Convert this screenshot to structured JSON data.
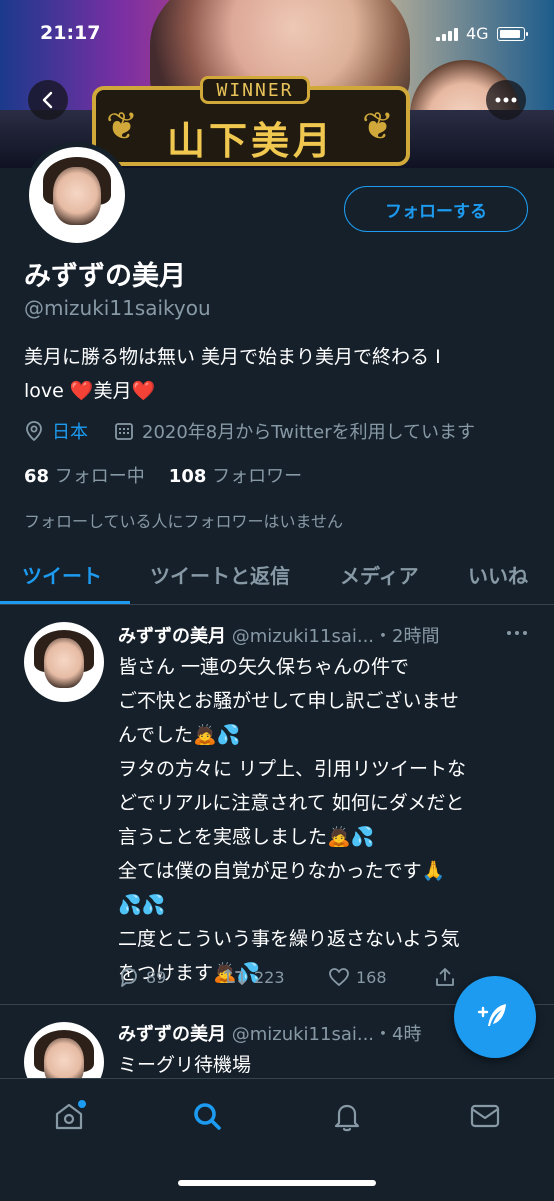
{
  "status_bar": {
    "time": "21:17",
    "network": "4G"
  },
  "banner": {
    "winner_label": "WINNER",
    "winner_name": "山下美月"
  },
  "header_buttons": {
    "back_icon": "back-arrow-icon",
    "more_icon": "more-dots-icon"
  },
  "profile": {
    "display_name": "みずずの美月",
    "handle": "@mizuki11saikyou",
    "follow_button": "フォローする",
    "bio_line1": "美月に勝る物は無い 美月で始まり美月で終わる I",
    "bio_line2_a": "love ",
    "bio_line2_b": "美月",
    "heart": "❤️",
    "location": "日本",
    "joined": "2020年8月からTwitterを利用しています",
    "following_count": "68",
    "following_label": "フォロー中",
    "followers_count": "108",
    "followers_label": "フォロワー",
    "no_followers_note": "フォローしている人にフォロワーはいません"
  },
  "tabs": [
    {
      "label": "ツイート",
      "active": true
    },
    {
      "label": "ツイートと返信",
      "active": false
    },
    {
      "label": "メディア",
      "active": false
    },
    {
      "label": "いいね",
      "active": false
    }
  ],
  "tweets": [
    {
      "name": "みずずの美月",
      "handle": "@mizuki11sai...",
      "time": "・2時間",
      "lines": [
        "皆さん 一連の矢久保ちゃんの件で",
        "ご不快とお騒がせして申し訳ございませ",
        "んでした🙇💦",
        "ヲタの方々に リプ上、引用リツイートな",
        "どでリアルに注意されて 如何にダメだと",
        "言うことを実感しました🙇💦",
        "全ては僕の自覚が足りなかったです🙏",
        "💦💦",
        "二度とこういう事を繰り返さないよう気",
        "をつけます🙇💦"
      ],
      "replies": "89",
      "retweets": "223",
      "likes": "168"
    },
    {
      "name": "みずずの美月",
      "handle": "@mizuki11sai...",
      "time": "・4時",
      "lines": [
        "ミーグリ待機場"
      ]
    }
  ],
  "bottom_nav": [
    "home-icon",
    "search-icon",
    "notifications-icon",
    "messages-icon"
  ],
  "colors": {
    "accent": "#1d9bf0",
    "background": "#15202b",
    "muted": "#8899a6",
    "heart": "#e0245e"
  }
}
